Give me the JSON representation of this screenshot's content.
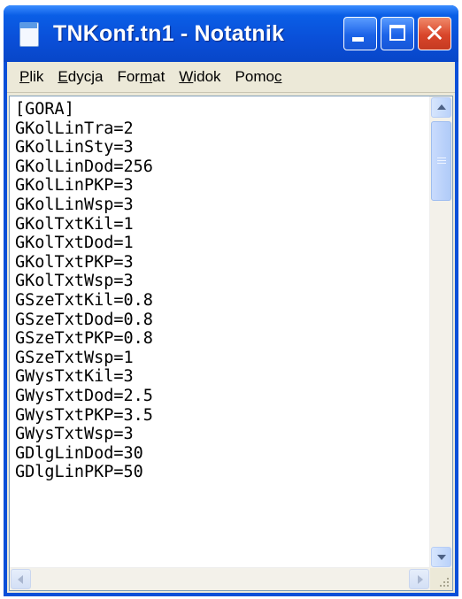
{
  "window": {
    "title": "TNKonf.tn1 - Notatnik",
    "controls": {
      "minimize": "minimize",
      "maximize": "maximize",
      "close": "close"
    }
  },
  "menu": [
    {
      "id": "plik",
      "pre": "",
      "acc": "P",
      "post": "lik"
    },
    {
      "id": "edycja",
      "pre": "",
      "acc": "E",
      "post": "dycja"
    },
    {
      "id": "format",
      "pre": "For",
      "acc": "m",
      "post": "at"
    },
    {
      "id": "widok",
      "pre": "",
      "acc": "W",
      "post": "idok"
    },
    {
      "id": "pomoc",
      "pre": "Pomo",
      "acc": "c",
      "post": ""
    }
  ],
  "editor": {
    "lines": [
      "[GORA]",
      "GKolLinTra=2",
      "GKolLinSty=3",
      "GKolLinDod=256",
      "GKolLinPKP=3",
      "GKolLinWsp=3",
      "GKolTxtKil=1",
      "GKolTxtDod=1",
      "GKolTxtPKP=3",
      "GKolTxtWsp=3",
      "GSzeTxtKil=0.8",
      "GSzeTxtDod=0.8",
      "GSzeTxtPKP=0.8",
      "GSzeTxtWsp=1",
      "GWysTxtKil=3",
      "GWysTxtDod=2.5",
      "GWysTxtPKP=3.5",
      "GWysTxtWsp=3",
      "GDlgLinDod=30",
      "GDlgLinPKP=50"
    ]
  },
  "colors": {
    "titlebar": "#0a4fd8",
    "close": "#d9452a",
    "client": "#ece9d8"
  }
}
